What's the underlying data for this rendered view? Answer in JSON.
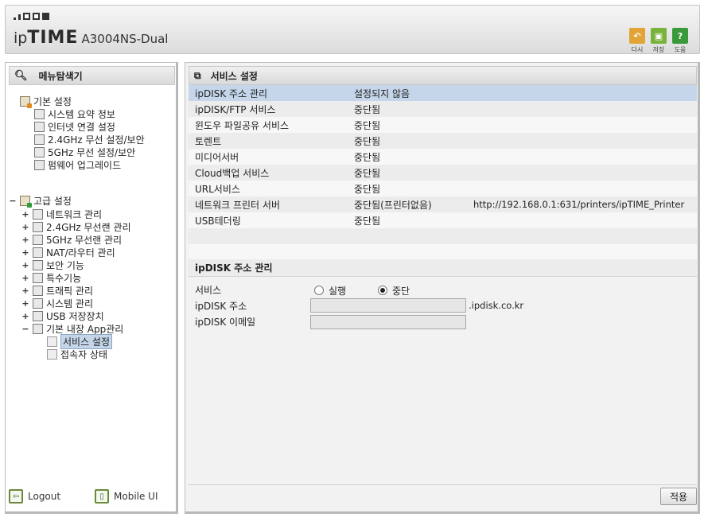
{
  "header": {
    "brand_ip": "ip",
    "brand_time": "TIME",
    "model": "A3004NS-Dual",
    "buttons": [
      {
        "label": "다시",
        "icon": "undo-icon",
        "color": "#e3a437"
      },
      {
        "label": "저장",
        "icon": "save-icon",
        "color": "#7ab33c"
      },
      {
        "label": "도움",
        "icon": "help-icon",
        "color": "#3a9a3a"
      }
    ]
  },
  "sidebar": {
    "title": "메뉴탐색기",
    "basic": {
      "label": "기본 설정",
      "items": [
        "시스템 요약 정보",
        "인터넷 연결 설정",
        "2.4GHz 무선 설정/보안",
        "5GHz 무선 설정/보안",
        "펌웨어 업그레이드"
      ]
    },
    "advanced": {
      "label": "고급 설정",
      "items": [
        "네트워크 관리",
        "2.4GHz 무선랜 관리",
        "5GHz 무선랜 관리",
        "NAT/라우터 관리",
        "보안 기능",
        "특수기능",
        "트래픽 관리",
        "시스템 관리",
        "USB 저장장치",
        "기본 내장 App관리"
      ],
      "app_children": [
        "서비스 설정",
        "접속자 상태"
      ]
    },
    "footer": {
      "logout": "Logout",
      "mobile": "Mobile UI"
    }
  },
  "main": {
    "title": "서비스 설정",
    "services": [
      {
        "name": "ipDISK 주소 관리",
        "status": "설정되지 않음",
        "extra": ""
      },
      {
        "name": "ipDISK/FTP 서비스",
        "status": "중단됨",
        "extra": ""
      },
      {
        "name": "윈도우 파일공유 서비스",
        "status": "중단됨",
        "extra": ""
      },
      {
        "name": "토렌트",
        "status": "중단됨",
        "extra": ""
      },
      {
        "name": "미디어서버",
        "status": "중단됨",
        "extra": ""
      },
      {
        "name": "Cloud백업 서비스",
        "status": "중단됨",
        "extra": ""
      },
      {
        "name": "URL서비스",
        "status": "중단됨",
        "extra": ""
      },
      {
        "name": "네트워크 프린터 서버",
        "status": "중단됨(프린터없음)",
        "extra": "http://192.168.0.1:631/printers/ipTIME_Printer"
      },
      {
        "name": "USB테더링",
        "status": "중단됨",
        "extra": ""
      }
    ],
    "section": {
      "title": "ipDISK 주소 관리",
      "service_label": "서비스",
      "radio_run": "실행",
      "radio_stop": "중단",
      "selected": "중단",
      "address_label": "ipDISK 주소",
      "address_value": "",
      "address_suffix": ".ipdisk.co.kr",
      "email_label": "ipDISK 이메일",
      "email_value": ""
    },
    "apply_label": "적용"
  }
}
